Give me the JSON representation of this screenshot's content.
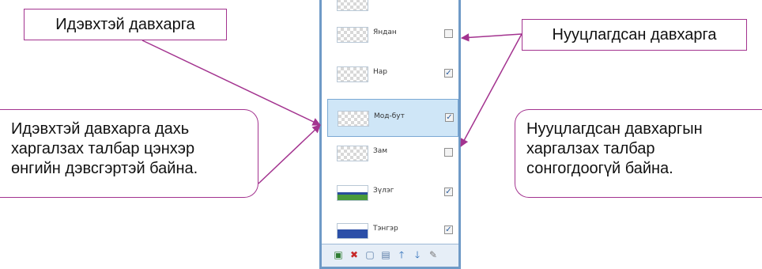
{
  "callouts": {
    "active_layer": "Идэвхтэй давхарга",
    "hidden_layer": "Нууцлагдсан давхарга",
    "active_note": [
      "Идэвхтэй давхарга дахь",
      "харгалзах талбар цэнхэр",
      "өнгийн дэвсгэртэй байна."
    ],
    "hidden_note": [
      "Нууцлагдсан давхаргын",
      "харгалзах талбар",
      "сонгогдоогүй байна."
    ]
  },
  "layers": [
    {
      "name": "Яндан",
      "checked": false,
      "selected": false,
      "thumb": "transparent"
    },
    {
      "name": "Нар",
      "checked": true,
      "selected": false,
      "thumb": "transparent"
    },
    {
      "name": "Мод-бут",
      "checked": true,
      "selected": true,
      "thumb": "transparent"
    },
    {
      "name": "Зам",
      "checked": false,
      "selected": false,
      "thumb": "transparent"
    },
    {
      "name": "Зүлэг",
      "checked": true,
      "selected": false,
      "thumb": "grass"
    },
    {
      "name": "Тэнгэр",
      "checked": true,
      "selected": false,
      "thumb": "sky"
    }
  ],
  "toolbar_icons": [
    "add-layer-icon",
    "delete-layer-icon",
    "duplicate-layer-icon",
    "merge-layer-icon",
    "move-up-icon",
    "move-down-icon",
    "properties-icon"
  ],
  "colors": {
    "callout_border": "#a3338f",
    "selected_row": "#cfe6f7",
    "panel_border": "#6f9ac7"
  }
}
